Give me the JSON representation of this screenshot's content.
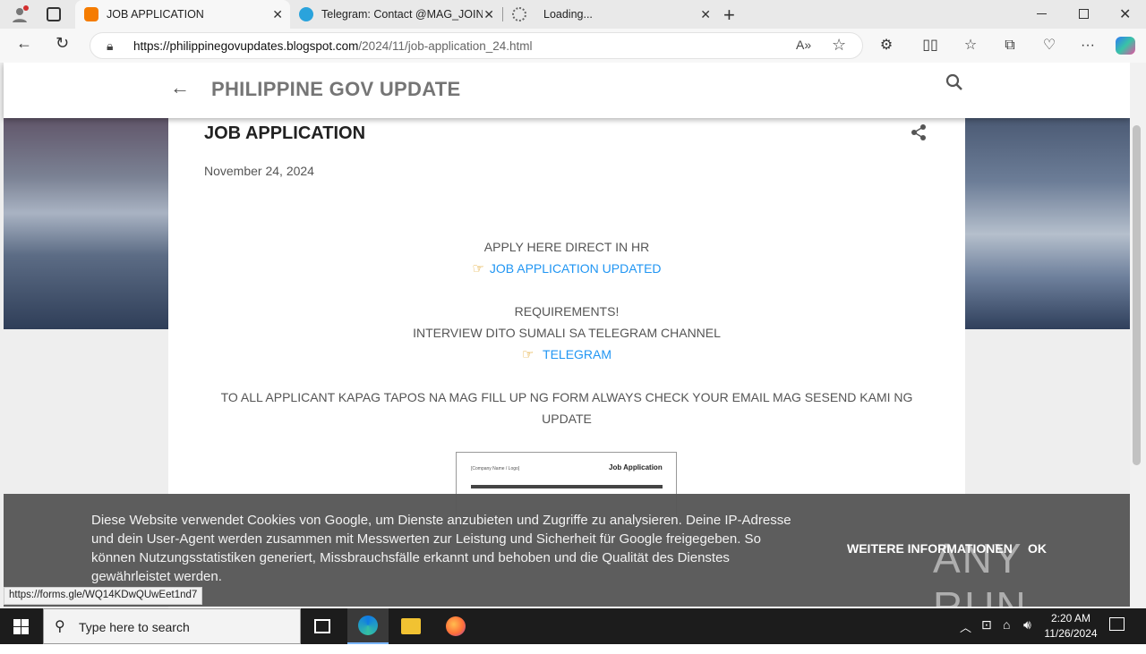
{
  "browser": {
    "tabs": [
      {
        "title": "JOB APPLICATION",
        "active": true,
        "favicon_color": "#f57c00"
      },
      {
        "title": "Telegram: Contact @MAG_JOIN_",
        "active": false,
        "favicon_color": "#2aa3dc"
      },
      {
        "title": "Loading...",
        "active": false,
        "favicon_color": ""
      }
    ],
    "url_host": "https://philippinegovupdates.blogspot.com",
    "url_path": "/2024/11/job-application_24.html"
  },
  "blog": {
    "title": "PHILIPPINE GOV UPDATE"
  },
  "post": {
    "title": "JOB APPLICATION",
    "date": "November 24, 2024",
    "apply_line": "APPLY HERE DIRECT IN HR",
    "apply_link": "JOB APPLICATION UPDATED",
    "requirements": "REQUIREMENTS!",
    "interview_line": "INTERVIEW DITO SUMALI SA TELEGRAM CHANNEL",
    "telegram_link": "TELEGRAM",
    "notice": "TO ALL APPLICANT KAPAG TAPOS NA MAG FILL UP NG FORM ALWAYS CHECK YOUR EMAIL MAG SESEND KAMI NG UPDATE",
    "form_image_title": "Job Application",
    "form_image_company": "[Company Name / Logo]"
  },
  "cookie": {
    "text": "Diese Website verwendet Cookies von Google, um Dienste anzubieten und Zugriffe zu analysieren. Deine IP-Adresse und dein User-Agent werden zusammen mit Messwerten zur Leistung und Sicherheit für Google freigegeben. So können Nutzungsstatistiken generiert, Missbrauchsfälle erkannt und behoben und die Qualität des Dienstes gewährleistet werden.",
    "more_label": "WEITERE INFORMATIONEN",
    "ok_label": "OK"
  },
  "watermark": "ANY RUN",
  "status_url": "https://forms.gle/WQ14KDwQUwEet1nd7",
  "taskbar": {
    "search_placeholder": "Type here to search",
    "time": "2:20 AM",
    "date": "11/26/2024"
  }
}
